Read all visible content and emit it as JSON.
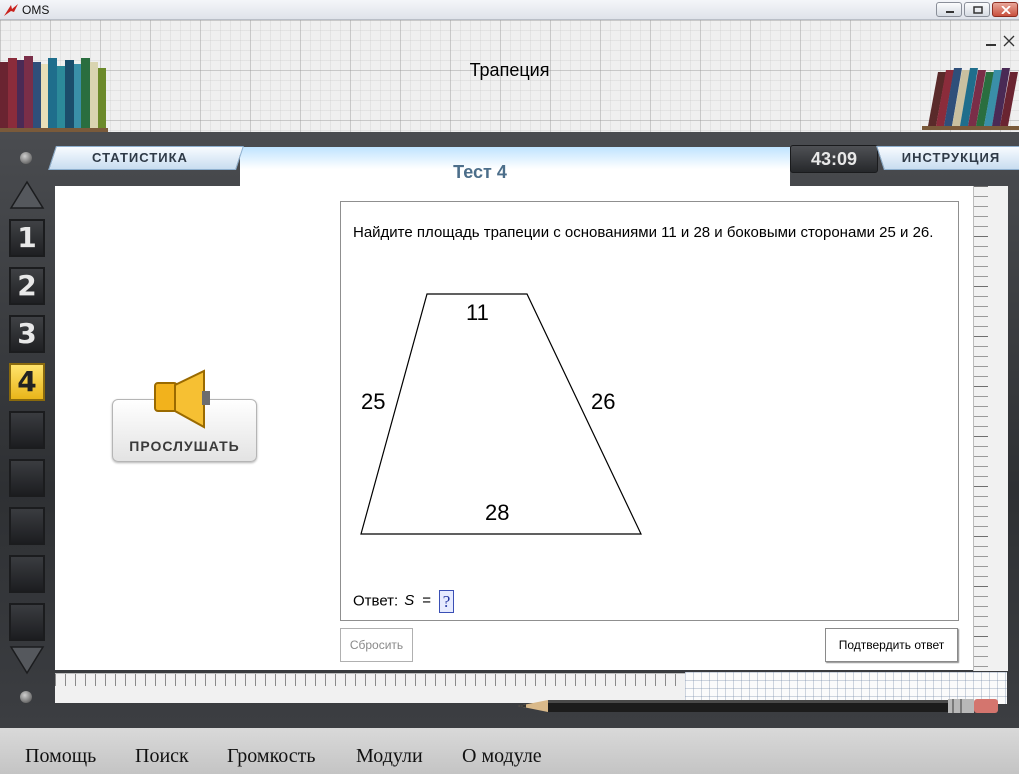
{
  "window": {
    "app_title": "OMS"
  },
  "header": {
    "page_title": "Трапеция"
  },
  "toolbar": {
    "stats_label": "СТАТИСТИКА",
    "instruction_label": "ИНСТРУКЦИЯ",
    "timer": "43:09",
    "test_title": "Тест 4"
  },
  "nav": {
    "questions": [
      {
        "label": "1",
        "state": "done"
      },
      {
        "label": "2",
        "state": "done"
      },
      {
        "label": "3",
        "state": "done"
      },
      {
        "label": "4",
        "state": "active"
      },
      {
        "label": "",
        "state": "empty"
      },
      {
        "label": "",
        "state": "empty"
      },
      {
        "label": "",
        "state": "empty"
      },
      {
        "label": "",
        "state": "empty"
      },
      {
        "label": "",
        "state": "empty"
      }
    ]
  },
  "listen": {
    "label": "ПРОСЛУШАТЬ"
  },
  "question": {
    "text": "Найдите площадь трапеции с основаниями 11 и 28 и боковыми сторонами 25 и 26.",
    "figure_labels": {
      "top": "11",
      "left": "25",
      "right": "26",
      "bottom": "28"
    },
    "answer_prefix": "Ответ:",
    "answer_var": "S",
    "answer_eq": "=",
    "answer_value": "?"
  },
  "buttons": {
    "reset": "Сбросить",
    "confirm": "Подтвердить ответ"
  },
  "menu": {
    "help": "Помощь",
    "search": "Поиск",
    "volume": "Громкость",
    "modules": "Модули",
    "about": "О модуле"
  },
  "colors": {
    "active_question": "#f2c530",
    "frame_dark": "#2e3033",
    "answer_box": "#3a4fb5"
  }
}
